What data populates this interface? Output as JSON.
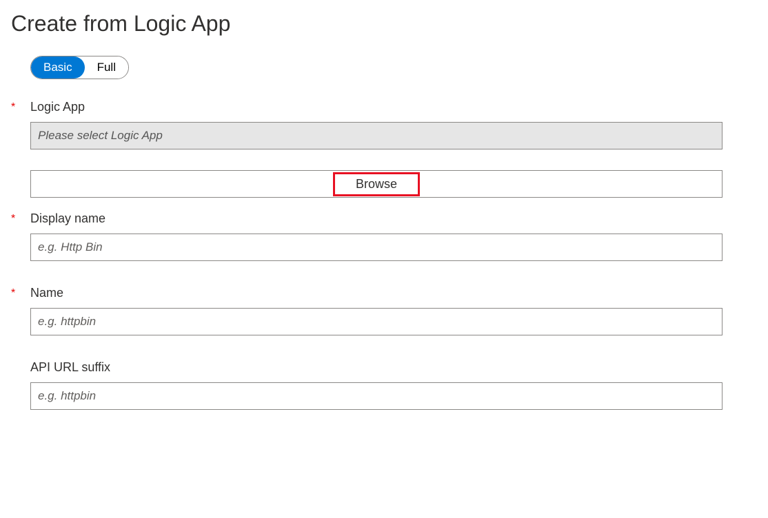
{
  "title": "Create from Logic App",
  "toggle": {
    "basic": "Basic",
    "full": "Full"
  },
  "fields": {
    "logicApp": {
      "label": "Logic App",
      "placeholder": "Please select Logic App",
      "required": true
    },
    "browse": {
      "label": "Browse"
    },
    "displayName": {
      "label": "Display name",
      "placeholder": "e.g. Http Bin",
      "required": true
    },
    "name": {
      "label": "Name",
      "placeholder": "e.g. httpbin",
      "required": true
    },
    "apiUrlSuffix": {
      "label": "API URL suffix",
      "placeholder": "e.g. httpbin",
      "required": false
    }
  }
}
